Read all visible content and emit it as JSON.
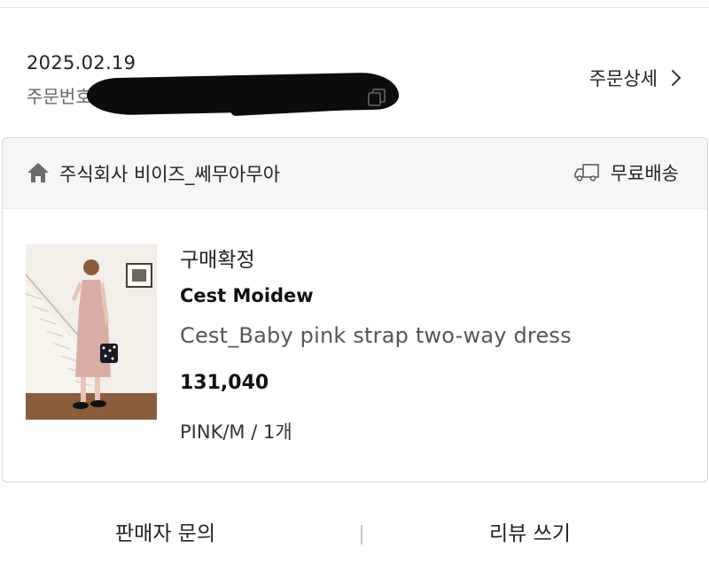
{
  "order": {
    "date": "2025.02.19",
    "number_label": "주문번호",
    "detail_link_label": "주문상세"
  },
  "seller": {
    "name": "주식회사 비이즈_쎄무아무아",
    "shipping_label": "무료배송"
  },
  "product": {
    "status": "구매확정",
    "brand": "Cest Moidew",
    "name": "Cest_Baby pink strap two-way dress",
    "price": "131,040",
    "option": "PINK/M / 1개"
  },
  "actions": {
    "seller_inquiry": "판매자 문의",
    "write_review": "리뷰 쓰기"
  },
  "icons": {
    "home": "home-icon",
    "truck": "truck-icon",
    "chevron": "chevron-right-icon",
    "copy": "copy-icon"
  },
  "colors": {
    "seller_bar_bg": "#f6f6f6",
    "border": "#d6d6d6",
    "text_primary": "#222222",
    "text_secondary": "#666666"
  }
}
